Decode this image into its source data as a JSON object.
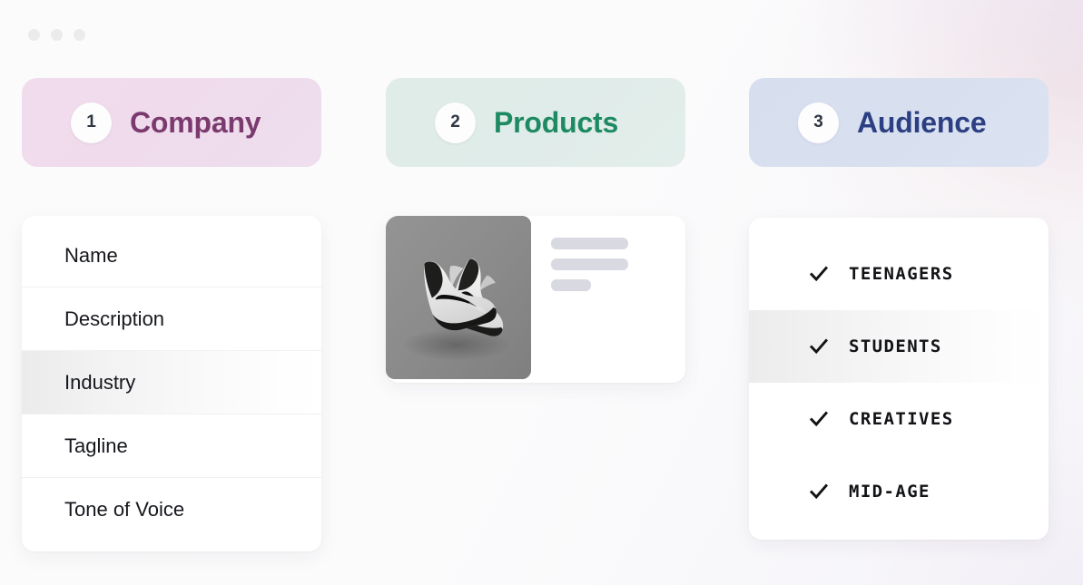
{
  "window": {
    "dots": [
      "close-dot",
      "minimize-dot",
      "maximize-dot"
    ]
  },
  "steps": [
    {
      "number": "1",
      "label": "Company",
      "accent": "#7b3a6f",
      "background": "#efdbeb"
    },
    {
      "number": "2",
      "label": "Products",
      "accent": "#1d8a62",
      "background": "#e0ece9"
    },
    {
      "number": "3",
      "label": "Audience",
      "accent": "#2c3f82",
      "background": "#d8e0f0"
    }
  ],
  "company": {
    "fields": [
      {
        "label": "Name",
        "selected": false
      },
      {
        "label": "Description",
        "selected": false
      },
      {
        "label": "Industry",
        "selected": true
      },
      {
        "label": "Tagline",
        "selected": false
      },
      {
        "label": "Tone of Voice",
        "selected": false
      }
    ]
  },
  "products": {
    "thumbnail_alt": "pair of black and white high-top sneakers",
    "skeleton_lines": [
      "long",
      "mid",
      "short"
    ]
  },
  "audience": {
    "segments": [
      {
        "label": "TEENAGERS",
        "checked": true,
        "selected": false
      },
      {
        "label": "STUDENTS",
        "checked": true,
        "selected": true
      },
      {
        "label": "CREATIVES",
        "checked": true,
        "selected": false
      },
      {
        "label": "MID-AGE",
        "checked": true,
        "selected": false
      }
    ]
  }
}
